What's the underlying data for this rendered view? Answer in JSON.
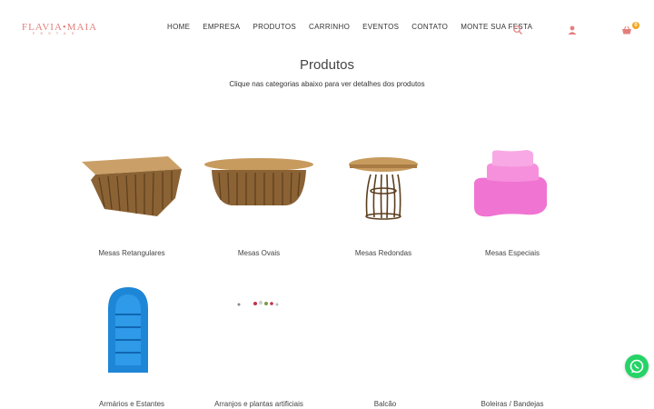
{
  "brand": {
    "logo_main": "FLAVIA•MAIA",
    "logo_sub": "FESTAS"
  },
  "nav": {
    "items": [
      "HOME",
      "EMPRESA",
      "PRODUTOS",
      "CARRINHO",
      "EVENTOS",
      "CONTATO",
      "MONTE SUA FESTA"
    ]
  },
  "header_icons": [
    "search-icon",
    "user-icon",
    "basket-icon"
  ],
  "cart": {
    "count": "0"
  },
  "page": {
    "title": "Produtos",
    "subtitle": "Clique nas categorias abaixo para ver detalhes dos produtos"
  },
  "categories": [
    "Mesas Retangulares",
    "Mesas Ovais",
    "Mesas Redondas",
    "Mesas Especiais",
    "Armários e Estantes",
    "Arranjos e plantas artificiais",
    "Balcão",
    "Boleiras / Bandejas"
  ],
  "colors": {
    "brand_pink": "#e2807e",
    "badge": "#f2a51f",
    "whatsapp": "#25d366",
    "text": "#333333"
  }
}
